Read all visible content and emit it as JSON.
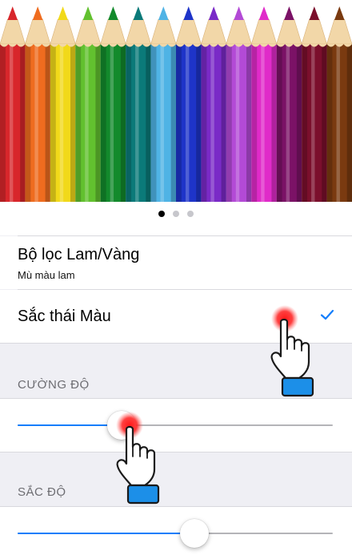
{
  "banner": {
    "pencil_colors": [
      "#d8262b",
      "#ef6c1f",
      "#f1d91a",
      "#62c12f",
      "#138a2c",
      "#0b7a79",
      "#4fb3e5",
      "#1e34c9",
      "#7a2ac7",
      "#b34ad6",
      "#e02bc9",
      "#7b1266",
      "#7b0f2c",
      "#7a3a10"
    ],
    "pages": [
      true,
      false,
      false
    ]
  },
  "rows": {
    "filter_title": "Bộ lọc Lam/Vàng",
    "filter_subtitle": "Mù màu lam",
    "tint_title": "Sắc thái Màu"
  },
  "sections": {
    "intensity_header": "CƯỜNG ĐỘ",
    "hue_header": "SẮC ĐỘ"
  },
  "sliders": {
    "intensity_value": 0.33,
    "hue_value": 0.56
  },
  "accent_color": "#147efb"
}
